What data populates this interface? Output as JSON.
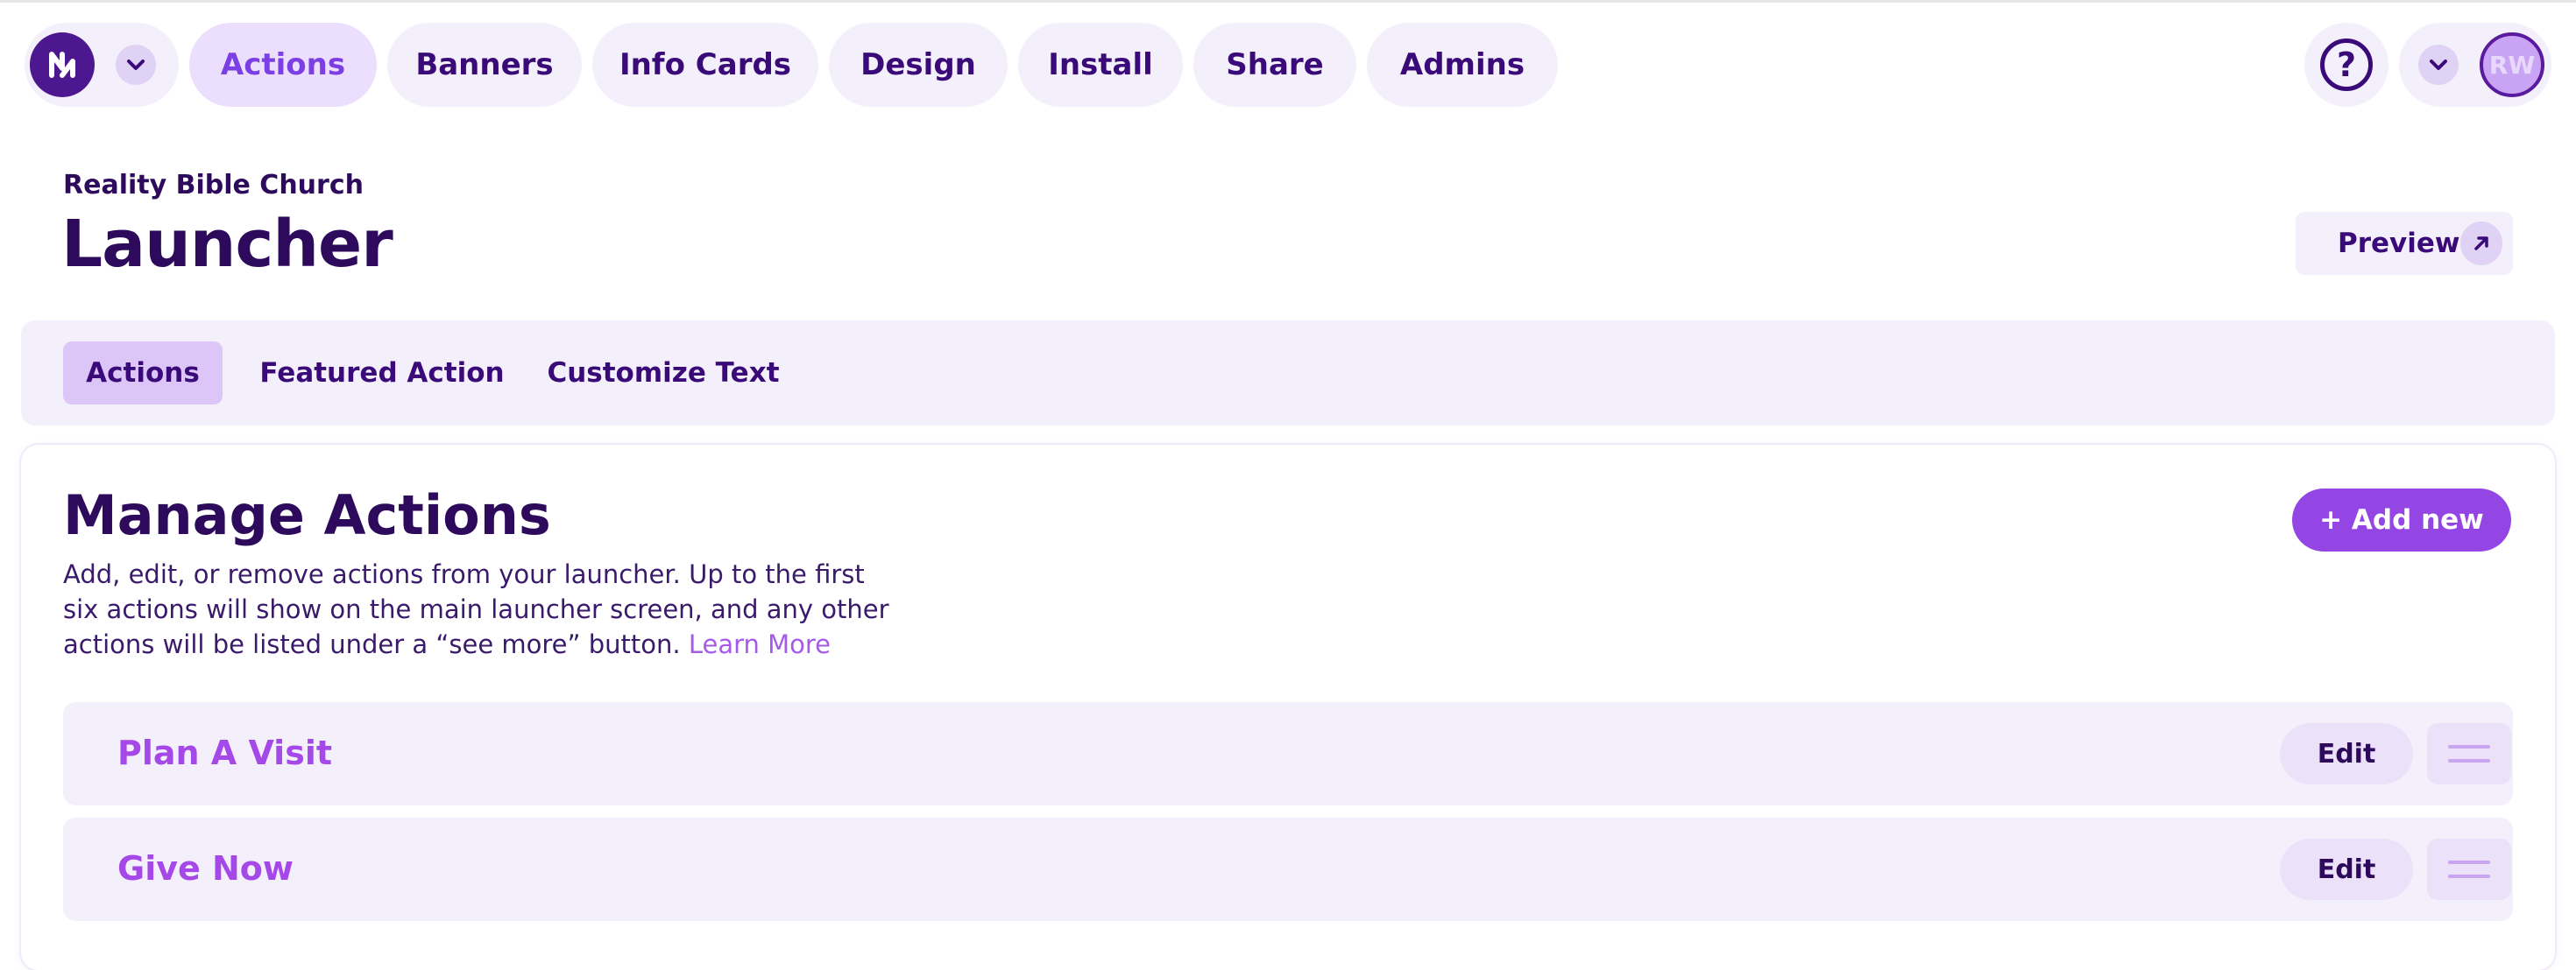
{
  "nav": {
    "logo_icon": "brand-logo-icon",
    "tabs": [
      {
        "label": "Actions",
        "active": true
      },
      {
        "label": "Banners",
        "active": false
      },
      {
        "label": "Info Cards",
        "active": false
      },
      {
        "label": "Design",
        "active": false
      },
      {
        "label": "Install",
        "active": false
      },
      {
        "label": "Share",
        "active": false
      },
      {
        "label": "Admins",
        "active": false
      }
    ],
    "help_icon": "question-icon",
    "help_glyph": "?",
    "user_initials": "RW"
  },
  "header": {
    "org_name": "Reality Bible Church",
    "title": "Launcher",
    "preview_label": "Preview"
  },
  "subtabs": [
    {
      "label": "Actions",
      "active": true
    },
    {
      "label": "Featured Action",
      "active": false
    },
    {
      "label": "Customize Text",
      "active": false
    }
  ],
  "manage": {
    "title": "Manage Actions",
    "description": "Add, edit, or remove actions from your launcher. Up to the first six actions will show on the main launcher screen, and any other actions will be listed under a “see more” button.",
    "learn_more": "Learn More",
    "add_label": "+ Add new",
    "edit_label": "Edit",
    "actions": [
      {
        "label": "Plan A Visit"
      },
      {
        "label": "Give Now"
      }
    ]
  },
  "colors": {
    "brand_dark": "#2d0a5c",
    "accent": "#9346e3",
    "pill_bg": "#f4f0fb",
    "active_pill_bg": "#ecdffd",
    "row_label": "#a548e8"
  }
}
